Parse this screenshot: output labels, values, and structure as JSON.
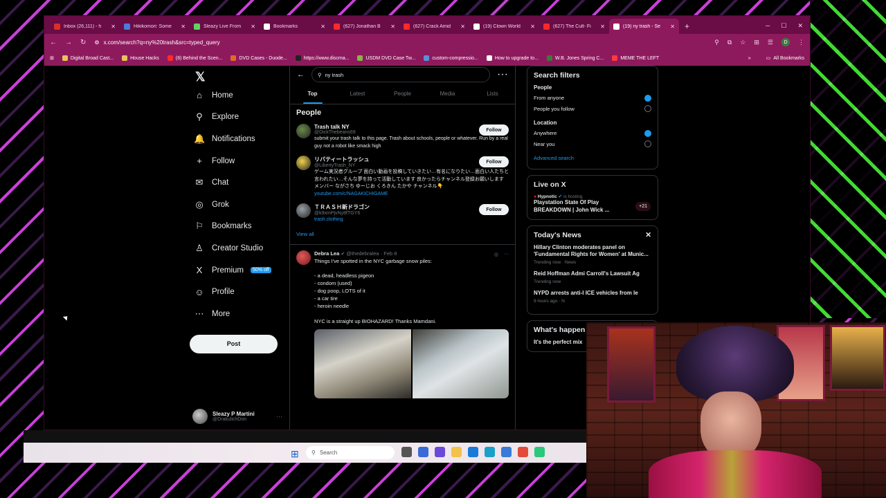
{
  "browser": {
    "tabs": [
      {
        "label": "Inbox (26,111) - h",
        "color": "#d93025"
      },
      {
        "label": "Hikikomori: Some",
        "color": "#4a7bd8"
      },
      {
        "label": "Sleazy Live From",
        "color": "#5fd35f"
      },
      {
        "label": "Bookmarks",
        "color": "#ffffff"
      },
      {
        "label": "(627) Jonathan B",
        "color": "#ff2a2a"
      },
      {
        "label": "(627) Crack Amid",
        "color": "#ff2a2a"
      },
      {
        "label": "(19) Clown World",
        "color": "#ffffff"
      },
      {
        "label": "(627) The Cult- Fi",
        "color": "#ff2a2a"
      },
      {
        "label": "(19) ny trash - Se",
        "color": "#ffffff",
        "active": true
      }
    ],
    "url": "x.com/search?q=ny%20trash&src=typed_query",
    "profile_initial": "D",
    "bookmarks": [
      {
        "label": "Digital Broad Cast...",
        "color": "#e8c35a"
      },
      {
        "label": "House Hacks",
        "color": "#e8c35a"
      },
      {
        "label": "(8) Behind the Scen...",
        "color": "#ff2a2a"
      },
      {
        "label": "DVD Cases - Duode...",
        "color": "#e06a2a"
      },
      {
        "label": "https://www.discma...",
        "color": "#222222"
      },
      {
        "label": "USDM DVD Case Tw...",
        "color": "#8ab34a"
      },
      {
        "label": "custom-compressio...",
        "color": "#5a8fd8"
      },
      {
        "label": "How to upgrade to...",
        "color": "#ffffff"
      },
      {
        "label": "W.B. Jones Spring C...",
        "color": "#3a7a3a"
      },
      {
        "label": "MEME THE LEFT",
        "color": "#ff3a3a"
      }
    ],
    "all_bookmarks": "All Bookmarks"
  },
  "nav": {
    "items": [
      {
        "label": "Home",
        "icon": "⌂"
      },
      {
        "label": "Explore",
        "icon": "⚲"
      },
      {
        "label": "Notifications",
        "icon": "🔔"
      },
      {
        "label": "Follow",
        "icon": "+"
      },
      {
        "label": "Chat",
        "icon": "✉"
      },
      {
        "label": "Grok",
        "icon": "◎"
      },
      {
        "label": "Bookmarks",
        "icon": "⚐"
      },
      {
        "label": "Creator Studio",
        "icon": "♙"
      },
      {
        "label": "Premium",
        "icon": "X"
      },
      {
        "label": "Profile",
        "icon": "☺"
      },
      {
        "label": "More",
        "icon": "⋯"
      }
    ],
    "premium_badge": "50% off",
    "post_label": "Post",
    "account": {
      "name": "Sleazy P Martini",
      "handle": "@DrakulichDon"
    }
  },
  "search": {
    "query": "ny trash",
    "tabs": [
      "Top",
      "Latest",
      "People",
      "Media",
      "Lists"
    ]
  },
  "people": {
    "heading": "People",
    "follow_label": "Follow",
    "list": [
      {
        "name": "Trash talk NY",
        "handle": "@DickThebeans69",
        "bio": "submit your trash talk to this page. Trash about schools, people or whatever. Run by a real guy not a robot like smack high",
        "link": "",
        "color": "#6a8a4a"
      },
      {
        "name": "リバティートラッシュ",
        "handle": "@LibertyTrash_NY",
        "bio": "ゲーム実況者グループ 面白い動画を投稿していきたい…有名になりたい…面白い人たちと言われたい…そんな夢を持って活動しています 良かったらチャンネル登録お願いします メンバー ながさち ゆーじお くろきん たかや チャンネル👇",
        "link": "youtube.com/c/NAGAKICHIGAME",
        "color": "#f2d24a"
      },
      {
        "name": "ＴＲＡＳＨ新ドラゴン",
        "handle": "@k9xmPjvNy8fTGY6",
        "bio": "",
        "link": "trash.clothing",
        "color": "#9aa0a6"
      }
    ],
    "view_all": "View all"
  },
  "tweet": {
    "name": "Debra Lea",
    "handle": "@thedebralea · Feb 8",
    "text": "Things I've spotted in the NYC garbage snow piles:\n\n- a dead, headless pigeon\n- condom (used)\n- dog poop, LOTS of it\n- a car tire\n- heroin needle\n\nNYC is a straight up BIOHAZARD! Thanks Mamdani."
  },
  "filters": {
    "title": "Search filters",
    "people_label": "People",
    "people_options": [
      {
        "label": "From anyone",
        "checked": true
      },
      {
        "label": "People you follow",
        "checked": false
      }
    ],
    "location_label": "Location",
    "location_options": [
      {
        "label": "Anywhere",
        "checked": true
      },
      {
        "label": "Near you",
        "checked": false
      }
    ],
    "advanced": "Advanced search"
  },
  "live": {
    "title": "Live on X",
    "host": "Hypnotic",
    "host_suffix": "is hosting",
    "stream_title": "Playstation State Of Play BREAKDOWN | John Wick ...",
    "listeners": "+21"
  },
  "news": {
    "title": "Today's News",
    "items": [
      {
        "headline": "Hillary Clinton moderates panel on 'Fundamental Rights for Women' at Munic...",
        "meta": "Trending now · News"
      },
      {
        "headline": "Reid Hoffman Admi Carroll's Lawsuit Ag",
        "meta": "Trending now"
      },
      {
        "headline": "NYPD arrests anti-I ICE vehicles from le",
        "meta": "9 hours ago · N"
      }
    ]
  },
  "whats_happening": {
    "title": "What's happen",
    "item": "It's the perfect mix"
  },
  "taskbar": {
    "search": "Search"
  }
}
